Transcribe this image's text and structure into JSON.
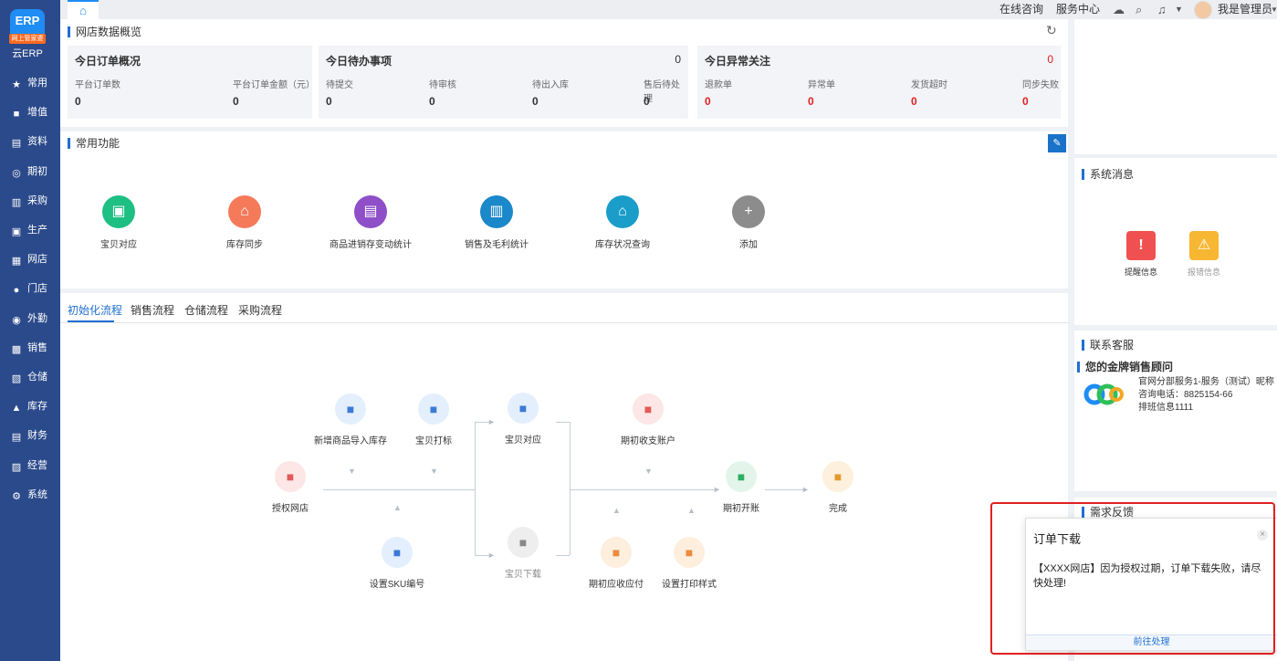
{
  "app": {
    "logo_line1": "ERP",
    "logo_line2": "网上管家婆",
    "name": "云ERP"
  },
  "sidebar": {
    "items": [
      {
        "label": "常用",
        "icon": "star-icon",
        "glyph": "★"
      },
      {
        "label": "增值",
        "icon": "plus-box-icon",
        "glyph": "■"
      },
      {
        "label": "资料",
        "icon": "file-icon",
        "glyph": "▤"
      },
      {
        "label": "期初",
        "icon": "clock-icon",
        "glyph": "◎"
      },
      {
        "label": "采购",
        "icon": "cart-icon",
        "glyph": "▥"
      },
      {
        "label": "生产",
        "icon": "factory-icon",
        "glyph": "▣"
      },
      {
        "label": "网店",
        "icon": "shop-icon",
        "glyph": "▦"
      },
      {
        "label": "门店",
        "icon": "store-icon",
        "glyph": "●"
      },
      {
        "label": "外勤",
        "icon": "location-icon",
        "glyph": "◉"
      },
      {
        "label": "销售",
        "icon": "sale-icon",
        "glyph": "▩"
      },
      {
        "label": "仓储",
        "icon": "warehouse-icon",
        "glyph": "▧"
      },
      {
        "label": "库存",
        "icon": "stock-icon",
        "glyph": "▲"
      },
      {
        "label": "财务",
        "icon": "finance-icon",
        "glyph": "▤"
      },
      {
        "label": "经营",
        "icon": "business-icon",
        "glyph": "▨"
      },
      {
        "label": "系统",
        "icon": "system-icon",
        "glyph": "⚙"
      }
    ]
  },
  "topbar": {
    "home_icon": "⌂",
    "online": "在线咨询",
    "service": "服务中心",
    "user": "我是管理员",
    "icons": [
      "cloud-icon",
      "search-icon",
      "bell-icon"
    ]
  },
  "overview": {
    "title": "网店数据概览",
    "refresh_icon": "↻",
    "orders": {
      "title": "今日订单概况",
      "labels": [
        "平台订单数",
        "平台订单金额（元）"
      ],
      "values": [
        "0",
        "0"
      ]
    },
    "todo": {
      "title": "今日待办事项",
      "count": "0",
      "labels": [
        "待提交",
        "待审核",
        "待出入库",
        "售后待处理"
      ],
      "values": [
        "0",
        "0",
        "0",
        "0"
      ]
    },
    "abnormal": {
      "title": "今日异常关注",
      "count": "0",
      "labels": [
        "退款单",
        "异常单",
        "发货超时",
        "同步失败"
      ],
      "values": [
        "0",
        "0",
        "0",
        "0"
      ],
      "color": "#e02020"
    }
  },
  "functions": {
    "title": "常用功能",
    "edit_icon": "✎",
    "items": [
      {
        "label": "宝贝对应",
        "color": "#1dbf83",
        "glyph": "▣"
      },
      {
        "label": "库存同步",
        "color": "#f57a5a",
        "glyph": "⌂"
      },
      {
        "label": "商品进销存变动统计",
        "color": "#8e4fc8",
        "glyph": "▤"
      },
      {
        "label": "销售及毛利统计",
        "color": "#1a88c9",
        "glyph": "▥"
      },
      {
        "label": "库存状况查询",
        "color": "#1a9dc9",
        "glyph": "⌂"
      },
      {
        "label": "添加",
        "color": "#8c8c8c",
        "glyph": "+"
      }
    ]
  },
  "flow_tabs": [
    "初始化流程",
    "销售流程",
    "仓储流程",
    "采购流程"
  ],
  "flow": {
    "nodes": [
      {
        "label": "新增商品导入库存",
        "bg": "#e3effc",
        "fg": "#3b7bd6"
      },
      {
        "label": "宝贝打标",
        "bg": "#e3effc",
        "fg": "#3b7bd6"
      },
      {
        "label": "宝贝对应",
        "bg": "#e3effc",
        "fg": "#3b7bd6"
      },
      {
        "label": "期初收支账户",
        "bg": "#fde6e6",
        "fg": "#e35a5a"
      },
      {
        "label": "授权网店",
        "bg": "#fde6e6",
        "fg": "#e35a5a"
      },
      {
        "label": "期初开账",
        "bg": "#e3f5ea",
        "fg": "#2fae63"
      },
      {
        "label": "完成",
        "bg": "#fdf0dc",
        "fg": "#e59a2f"
      },
      {
        "label": "设置SKU编号",
        "bg": "#e3effc",
        "fg": "#3b7bd6"
      },
      {
        "label": "宝贝下载",
        "bg": "#eeeeee",
        "fg": "#888"
      },
      {
        "label": "期初应收应付",
        "bg": "#fdeedd",
        "fg": "#ec8a3f"
      },
      {
        "label": "设置打印样式",
        "bg": "#fdeedd",
        "fg": "#ec8a3f"
      }
    ]
  },
  "messages": {
    "title": "系统消息",
    "items": [
      {
        "label": "提醒信息",
        "color": "#f05050",
        "glyph": "!"
      },
      {
        "label": "报错信息",
        "color": "#f7b733",
        "glyph": "⚠"
      }
    ]
  },
  "contact": {
    "title": "联系客服",
    "subtitle": "您的金牌销售顾问",
    "lines": [
      "官网分部服务1-服务（测试）昵称",
      "咨询电话：8825154-66",
      "排班信息1111"
    ]
  },
  "feedback": {
    "title": "需求反馈"
  },
  "popup": {
    "title": "订单下载",
    "message": "【XXXX网店】因为授权过期，订单下载失败，请尽快处理!",
    "action": "前往处理",
    "close_icon": "×"
  }
}
